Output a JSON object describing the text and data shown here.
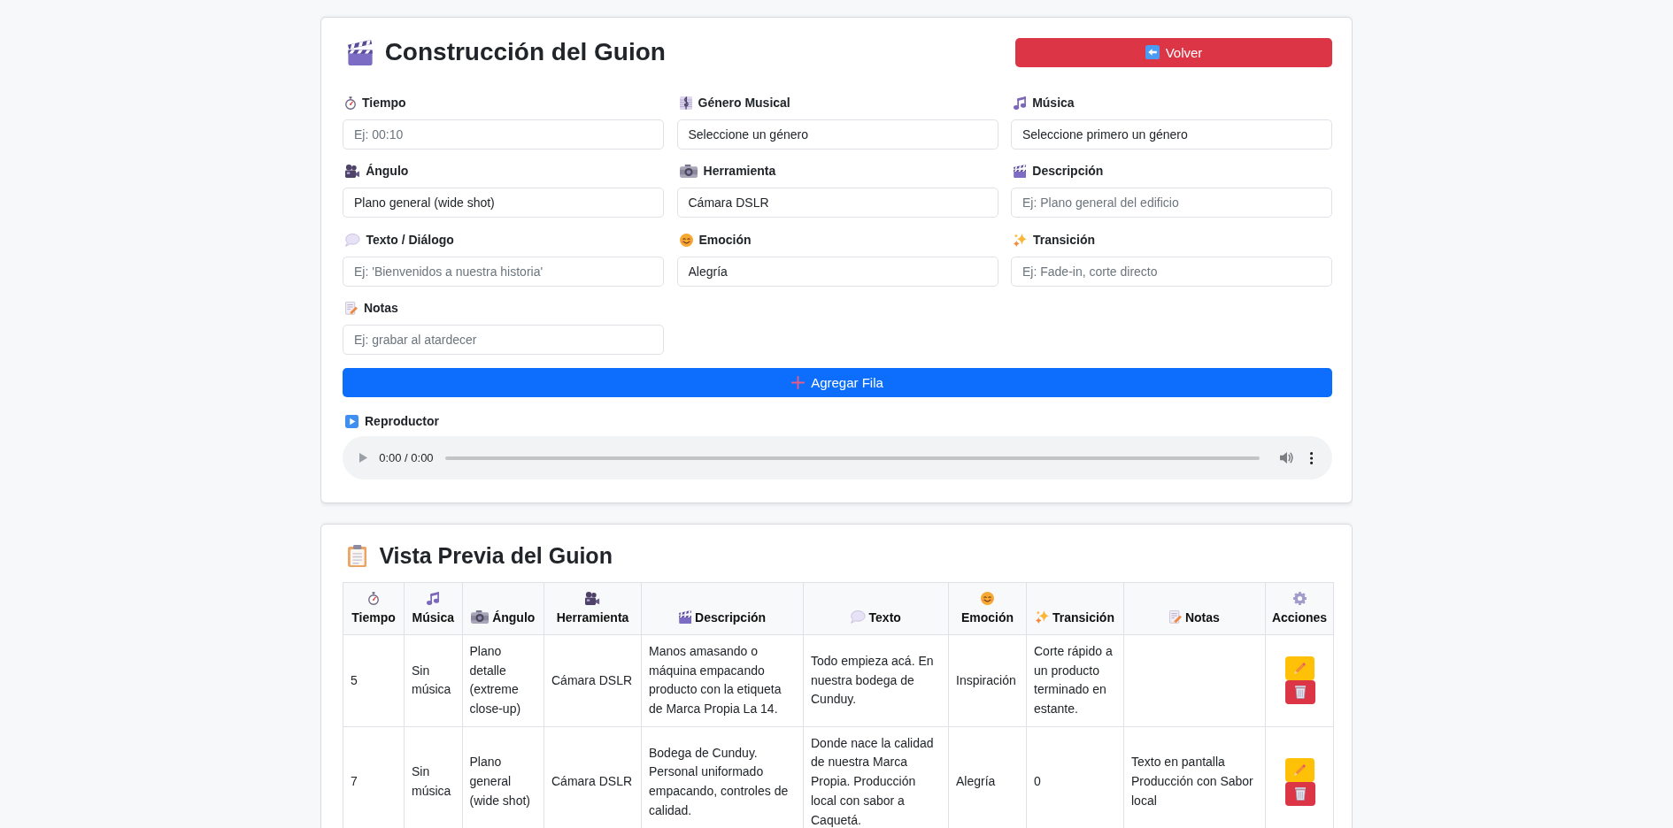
{
  "builder": {
    "title": "Construcción del Guion",
    "back_button": "Volver",
    "fields": [
      {
        "label": "Tiempo",
        "placeholder": "Ej: 00:10"
      },
      {
        "label": "Género Musical",
        "value": "Seleccione un género"
      },
      {
        "label": "Música",
        "value": "Seleccione primero un género"
      },
      {
        "label": "Ángulo",
        "value": "Plano general (wide shot)"
      },
      {
        "label": "Herramienta",
        "value": "Cámara DSLR"
      },
      {
        "label": "Descripción",
        "placeholder": "Ej: Plano general del edificio"
      },
      {
        "label": "Texto / Diálogo",
        "placeholder": "Ej: 'Bienvenidos a nuestra historia'"
      },
      {
        "label": "Emoción",
        "value": "Alegría"
      },
      {
        "label": "Transición",
        "placeholder": "Ej: Fade-in, corte directo"
      },
      {
        "label": "Notas",
        "placeholder": "Ej: grabar al atardecer"
      }
    ],
    "add_button": "Agregar Fila",
    "player": {
      "label": "Reproductor",
      "time": "0:00 / 0:00",
      "level": 0
    }
  },
  "preview": {
    "title": "Vista Previa del Guion",
    "table": {
      "columns": [
        "Tiempo",
        "Música",
        "Ángulo",
        "Herramienta",
        "Descripción",
        "Texto",
        "Emoción",
        "Transición",
        "Notas",
        "Acciones"
      ],
      "rows": [
        {
          "time": "5",
          "music": "Sin música",
          "angle": "Plano detalle (extreme close-up)",
          "tool": "Cámara DSLR",
          "description": "Manos amasando o máquina empacando producto con la etiqueta de Marca Propia La 14.",
          "text": "Todo empieza acá. En nuestra bodega de Cunduy.",
          "emotion": "Inspiración",
          "transition": "Corte rápido a un producto terminado en estante."
        },
        {
          "time": "7",
          "music": "Sin música",
          "angle": "Plano general (wide shot)",
          "tool": "Cámara DSLR",
          "description": "Bodega de Cunduy. Personal uniformado empacando, controles de calidad.",
          "text": "Donde nace la calidad de nuestra Marca Propia. Producción local con sabor a Caquetá.",
          "emotion": "Alegría",
          "transition": "0",
          "notes": "Texto en pantalla Producción con Sabor local"
        }
      ]
    }
  }
}
